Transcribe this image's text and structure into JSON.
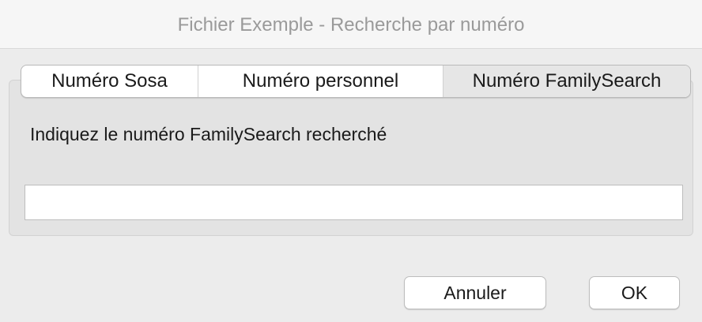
{
  "window": {
    "title": "Fichier Exemple - Recherche par numéro"
  },
  "tabs": [
    {
      "label": "Numéro Sosa",
      "selected": false
    },
    {
      "label": "Numéro personnel",
      "selected": false
    },
    {
      "label": "Numéro FamilySearch",
      "selected": true
    }
  ],
  "form": {
    "prompt": "Indiquez le numéro FamilySearch recherché",
    "input_value": ""
  },
  "buttons": {
    "cancel_label": "Annuler",
    "ok_label": "OK"
  }
}
